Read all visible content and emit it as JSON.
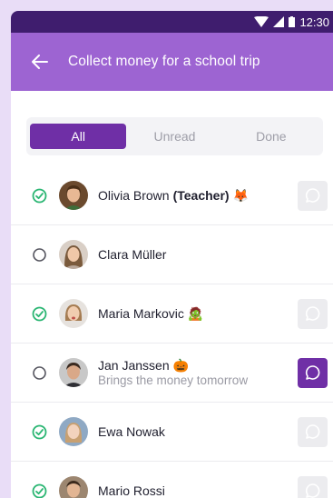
{
  "status_bar": {
    "time": "12:30"
  },
  "app_bar": {
    "title": "Collect money for a school trip"
  },
  "tabs": [
    {
      "label": "All",
      "active": true
    },
    {
      "label": "Unread",
      "active": false
    },
    {
      "label": "Done",
      "active": false
    }
  ],
  "colors": {
    "accent": "#6f2fa6",
    "app_bar": "#9d64d2",
    "status_bar": "#3f1d6e",
    "check": "#2bb673"
  },
  "people": [
    {
      "name": "Olivia Brown",
      "role": "(Teacher)",
      "emoji": "🦊",
      "paid": true,
      "subtitle": "",
      "message": "inactive"
    },
    {
      "name": "Clara Müller",
      "role": "",
      "emoji": "",
      "paid": false,
      "subtitle": "",
      "message": "none"
    },
    {
      "name": "Maria Markovic",
      "role": "",
      "emoji": "🧟",
      "paid": true,
      "subtitle": "",
      "message": "inactive"
    },
    {
      "name": "Jan Janssen",
      "role": "",
      "emoji": "🎃",
      "paid": false,
      "subtitle": "Brings the money tomorrow",
      "message": "active"
    },
    {
      "name": "Ewa Nowak",
      "role": "",
      "emoji": "",
      "paid": true,
      "subtitle": "",
      "message": "inactive"
    },
    {
      "name": "Mario Rossi",
      "role": "",
      "emoji": "",
      "paid": true,
      "subtitle": "",
      "message": "inactive"
    }
  ]
}
